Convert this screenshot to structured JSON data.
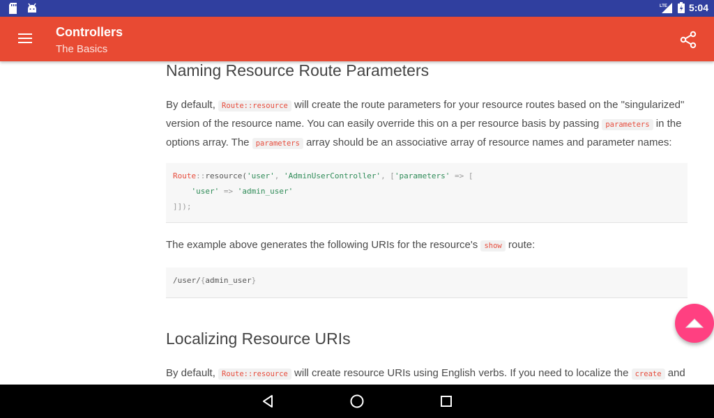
{
  "status_bar": {
    "time": "5:04",
    "network": "LTE"
  },
  "app_bar": {
    "title": "Controllers",
    "subtitle": "The Basics"
  },
  "section1": {
    "heading": "Naming Resource Route Parameters",
    "p1": {
      "t1": "By default, ",
      "code1": "Route::resource",
      "t2": " will create the route parameters for your resource routes based on the \"singularized\" version of the resource name. You can easily override this on a per resource basis by passing ",
      "code2": "parameters",
      "t3": " in the options array. The ",
      "code3": "parameters",
      "t4": " array should be an associative array of resource names and parameter names:"
    },
    "code_block": {
      "line1": {
        "a": "Route",
        "b": "::",
        "c": "resource(",
        "d": "'user'",
        "e": ", ",
        "f": "'AdminUserController'",
        "g": ", [",
        "h": "'parameters'",
        "i": " => ["
      },
      "line2": {
        "indent": "    ",
        "a": "'user'",
        "b": " => ",
        "c": "'admin_user'"
      },
      "line3": "]]);"
    },
    "p2": {
      "t1": "The example above generates the following URIs for the resource's ",
      "code1": "show",
      "t2": " route:"
    },
    "uri_block": {
      "a": "/user/",
      "b": "{",
      "c": "admin_user",
      "d": "}"
    }
  },
  "section2": {
    "heading": "Localizing Resource URIs",
    "p1": {
      "t1": "By default, ",
      "code1": "Route::resource",
      "t2": " will create resource URIs using English verbs. If you need to localize the ",
      "code2": "create",
      "t3": " and"
    }
  },
  "colors": {
    "status_bar": "#303f9f",
    "app_bar": "#e84a33",
    "fab": "#ff4081",
    "inline_code": "#e74c3c"
  },
  "icons": {
    "menu": "menu-icon",
    "share": "share-icon",
    "scroll_top": "chevron-up-icon",
    "back": "back-icon",
    "home": "home-icon",
    "recents": "recents-icon"
  }
}
